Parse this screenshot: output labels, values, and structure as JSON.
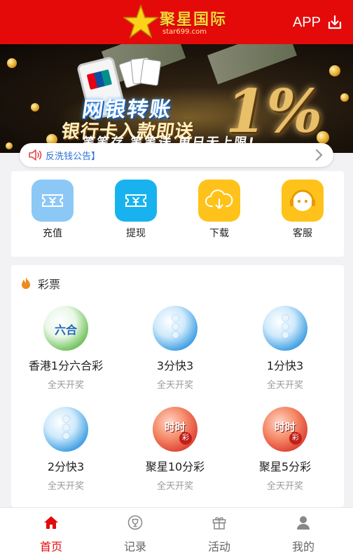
{
  "colors": {
    "brand_red": "#e50a0a",
    "notice_blue": "#2a6fd6",
    "muted": "#999999"
  },
  "header": {
    "logo_name": "聚星国际",
    "logo_domain": "star699.com",
    "app_label": "APP",
    "app_icon": "download-icon"
  },
  "banner": {
    "title": "网银转账",
    "subtitle": "银行卡入款即送",
    "percent": "1%",
    "bottom_text": "笔笔存 笔笔送 单日无上限!"
  },
  "notice": {
    "text": "反洗钱公告】",
    "icon": "speaker-icon"
  },
  "quick_actions": [
    {
      "label": "充值",
      "icon": "ticket-icon",
      "color": "#8cc8f6"
    },
    {
      "label": "提现",
      "icon": "ticket-icon",
      "color": "#18b3ee"
    },
    {
      "label": "下载",
      "icon": "cloud-download-icon",
      "color": "#ffc21a"
    },
    {
      "label": "客服",
      "icon": "headset-icon",
      "color": "#ffc21a"
    }
  ],
  "lottery": {
    "title": "彩票",
    "icon": "flame-icon",
    "games": [
      {
        "name": "香港1分六合彩",
        "status": "全天开奖",
        "ball": "green",
        "ball_text": "六合"
      },
      {
        "name": "3分快3",
        "status": "全天开奖",
        "ball": "blue",
        "ball_text": ""
      },
      {
        "name": "1分快3",
        "status": "全天开奖",
        "ball": "blue",
        "ball_text": ""
      },
      {
        "name": "2分快3",
        "status": "全天开奖",
        "ball": "blue",
        "ball_text": ""
      },
      {
        "name": "聚星10分彩",
        "status": "全天开奖",
        "ball": "red",
        "ball_text": "时时"
      },
      {
        "name": "聚星5分彩",
        "status": "全天开奖",
        "ball": "red",
        "ball_text": "时时"
      }
    ],
    "red_badge": "彩"
  },
  "tabbar": [
    {
      "label": "首页",
      "icon": "home-icon",
      "active": true
    },
    {
      "label": "记录",
      "icon": "trophy-icon",
      "active": false
    },
    {
      "label": "活动",
      "icon": "gift-icon",
      "active": false
    },
    {
      "label": "我的",
      "icon": "user-icon",
      "active": false
    }
  ]
}
